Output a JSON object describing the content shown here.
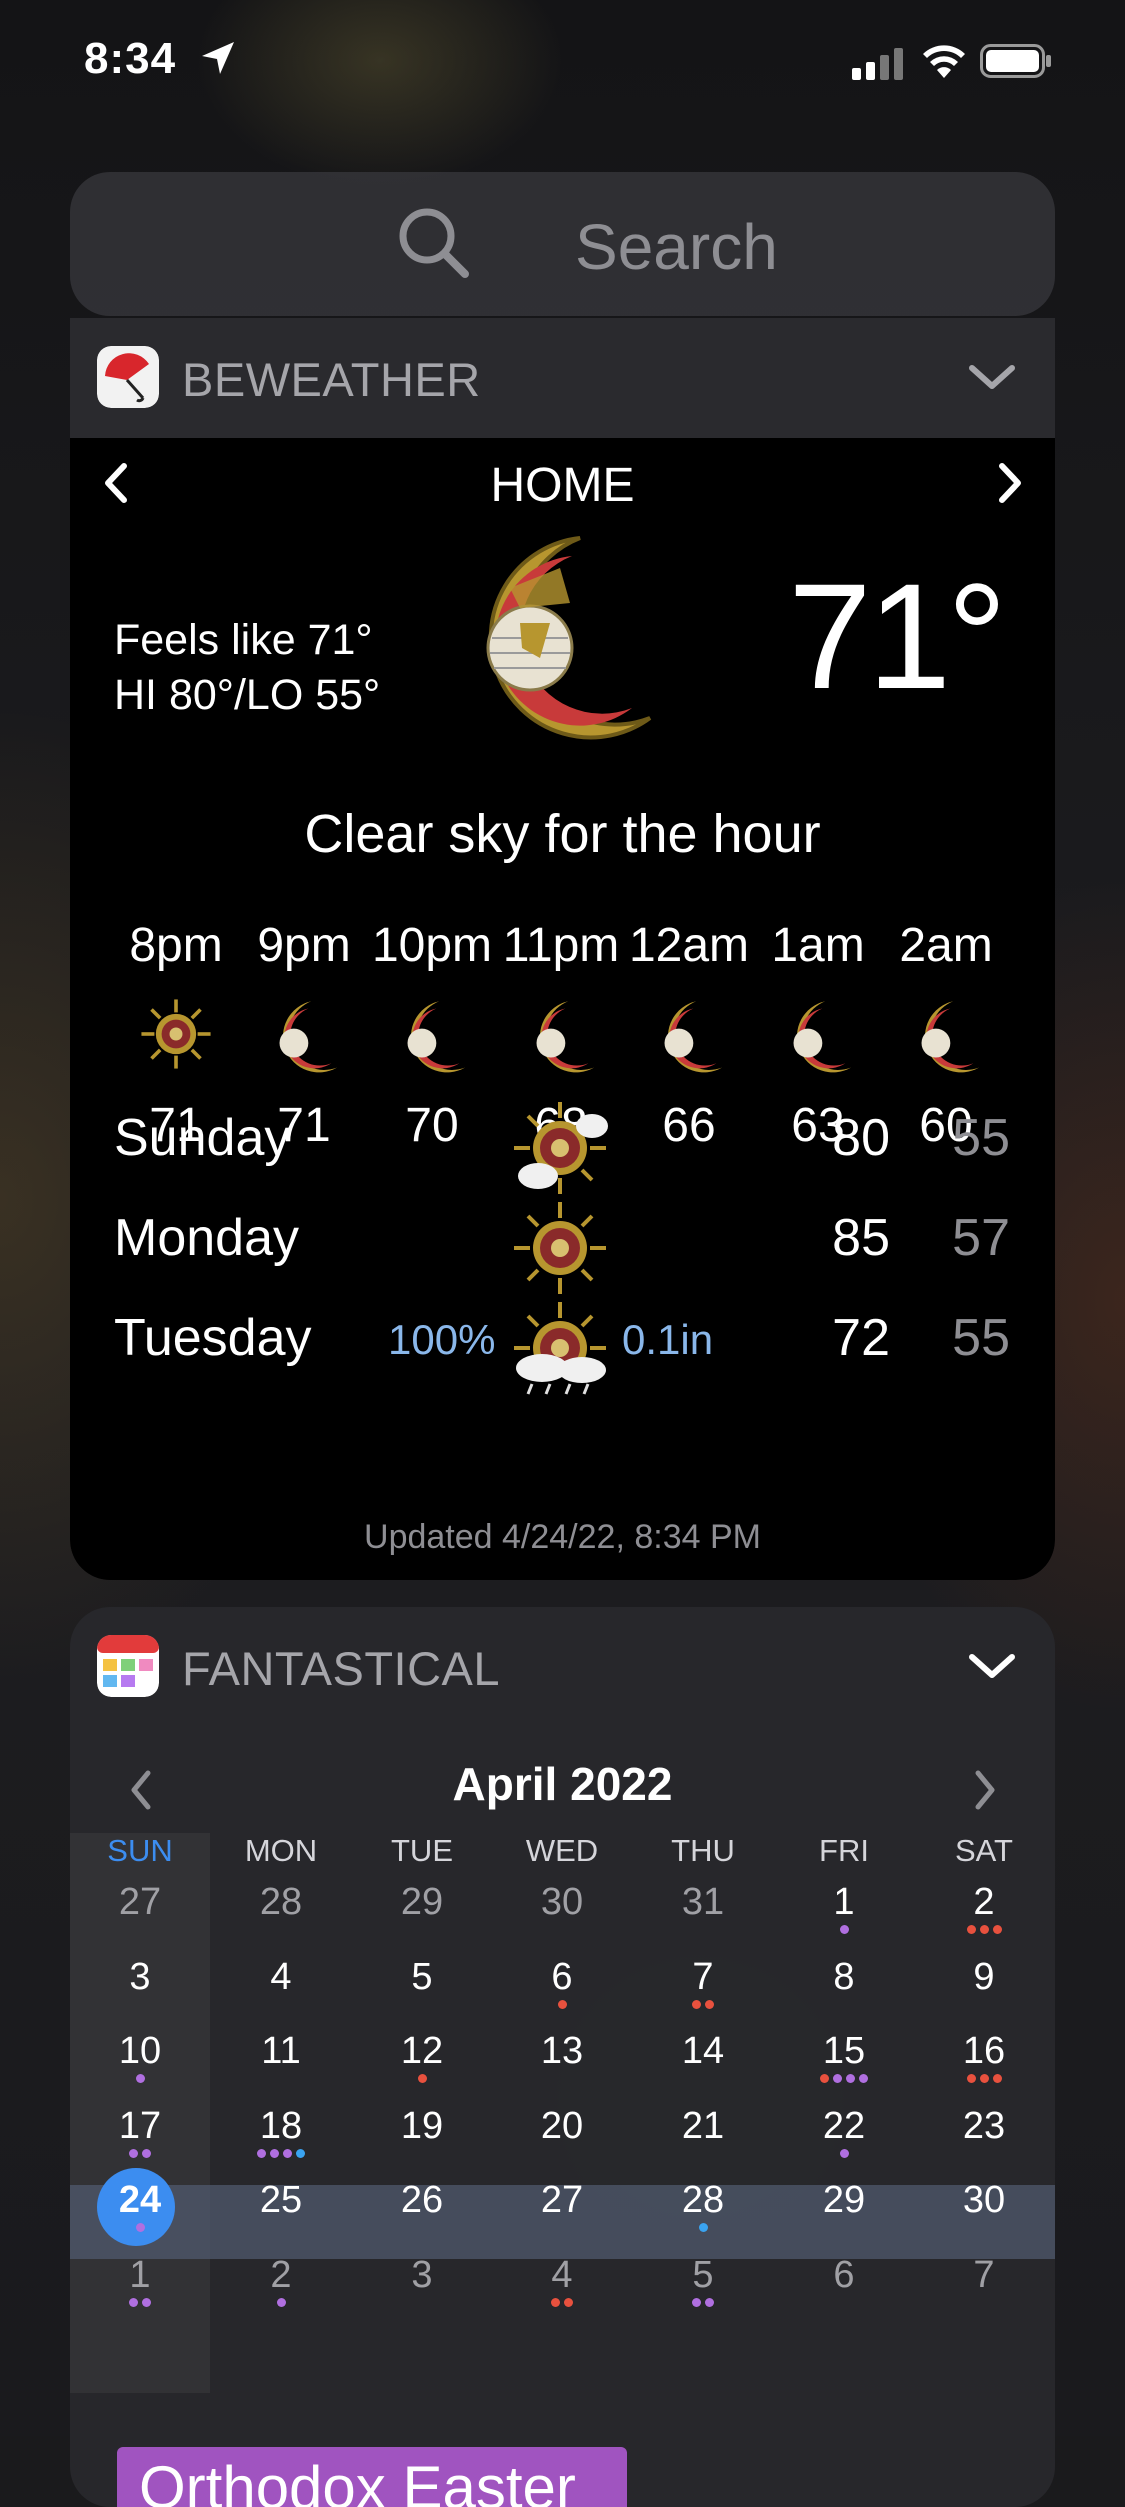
{
  "status_bar": {
    "time": "8:34"
  },
  "search": {
    "placeholder": "Search"
  },
  "beweather": {
    "app_name": "BEWEATHER",
    "location": "HOME",
    "feels_like": "Feels like 71°",
    "hi_lo": "HI 80°/LO 55°",
    "current_temp": "71°",
    "summary": "Clear sky for the hour",
    "hourly": [
      {
        "time": "8pm",
        "temp": "71",
        "icon": "sun-icon"
      },
      {
        "time": "9pm",
        "temp": "71",
        "icon": "moon-icon"
      },
      {
        "time": "10pm",
        "temp": "70",
        "icon": "moon-icon"
      },
      {
        "time": "11pm",
        "temp": "68",
        "icon": "moon-icon"
      },
      {
        "time": "12am",
        "temp": "66",
        "icon": "moon-icon"
      },
      {
        "time": "1am",
        "temp": "63",
        "icon": "moon-icon"
      },
      {
        "time": "2am",
        "temp": "60",
        "icon": "moon-icon"
      }
    ],
    "daily": [
      {
        "day": "Sunday",
        "pop": "",
        "precip": "",
        "hi": "80",
        "lo": "55",
        "icon": "sun-cloud-icon"
      },
      {
        "day": "Monday",
        "pop": "",
        "precip": "",
        "hi": "85",
        "lo": "57",
        "icon": "sun-icon"
      },
      {
        "day": "Tuesday",
        "pop": "100%",
        "precip": "0.1in",
        "hi": "72",
        "lo": "55",
        "icon": "sun-rain-icon"
      }
    ],
    "updated": "Updated 4/24/22, 8:34 PM"
  },
  "fantastical": {
    "app_name": "FANTASTICAL",
    "month": "April 2022",
    "weekdays": [
      "SUN",
      "MON",
      "TUE",
      "WED",
      "THU",
      "FRI",
      "SAT"
    ],
    "weeks": [
      [
        "27",
        "28",
        "29",
        "30",
        "31",
        "1",
        "2"
      ],
      [
        "3",
        "4",
        "5",
        "6",
        "7",
        "8",
        "9"
      ],
      [
        "10",
        "11",
        "12",
        "13",
        "14",
        "15",
        "16"
      ],
      [
        "17",
        "18",
        "19",
        "20",
        "21",
        "22",
        "23"
      ],
      [
        "24",
        "25",
        "26",
        "27",
        "28",
        "29",
        "30"
      ],
      [
        "1",
        "2",
        "3",
        "4",
        "5",
        "6",
        "7"
      ]
    ],
    "today": "24",
    "event": "Orthodox Easter",
    "colors": {
      "today": "#3c8df0",
      "sunday": "#3c8df0",
      "event": "#a054c0",
      "purple": "#b06fe0",
      "red": "#e8513e",
      "blue": "#3aa3f0"
    }
  }
}
